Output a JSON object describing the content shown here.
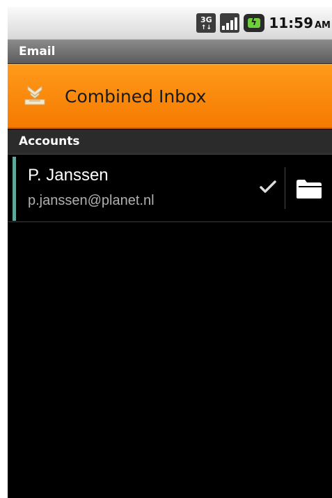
{
  "status_bar": {
    "network_type": "3G",
    "network_arrows": "↑↓",
    "time": "11:59",
    "ampm": "AM",
    "icons": [
      "3g-data-icon",
      "signal-strength-icon",
      "battery-charging-icon"
    ]
  },
  "header": {
    "title": "Email"
  },
  "combined_inbox": {
    "label": "Combined Inbox",
    "icon": "inbox-download-icon",
    "accent_color": "#F88A08"
  },
  "accounts_section": {
    "title": "Accounts",
    "items": [
      {
        "name": "P. Janssen",
        "email": "p.janssen@planet.nl",
        "color": "#5FA89A",
        "is_default": true,
        "check_icon": "checkmark-icon",
        "folder_icon": "folder-icon"
      }
    ]
  }
}
